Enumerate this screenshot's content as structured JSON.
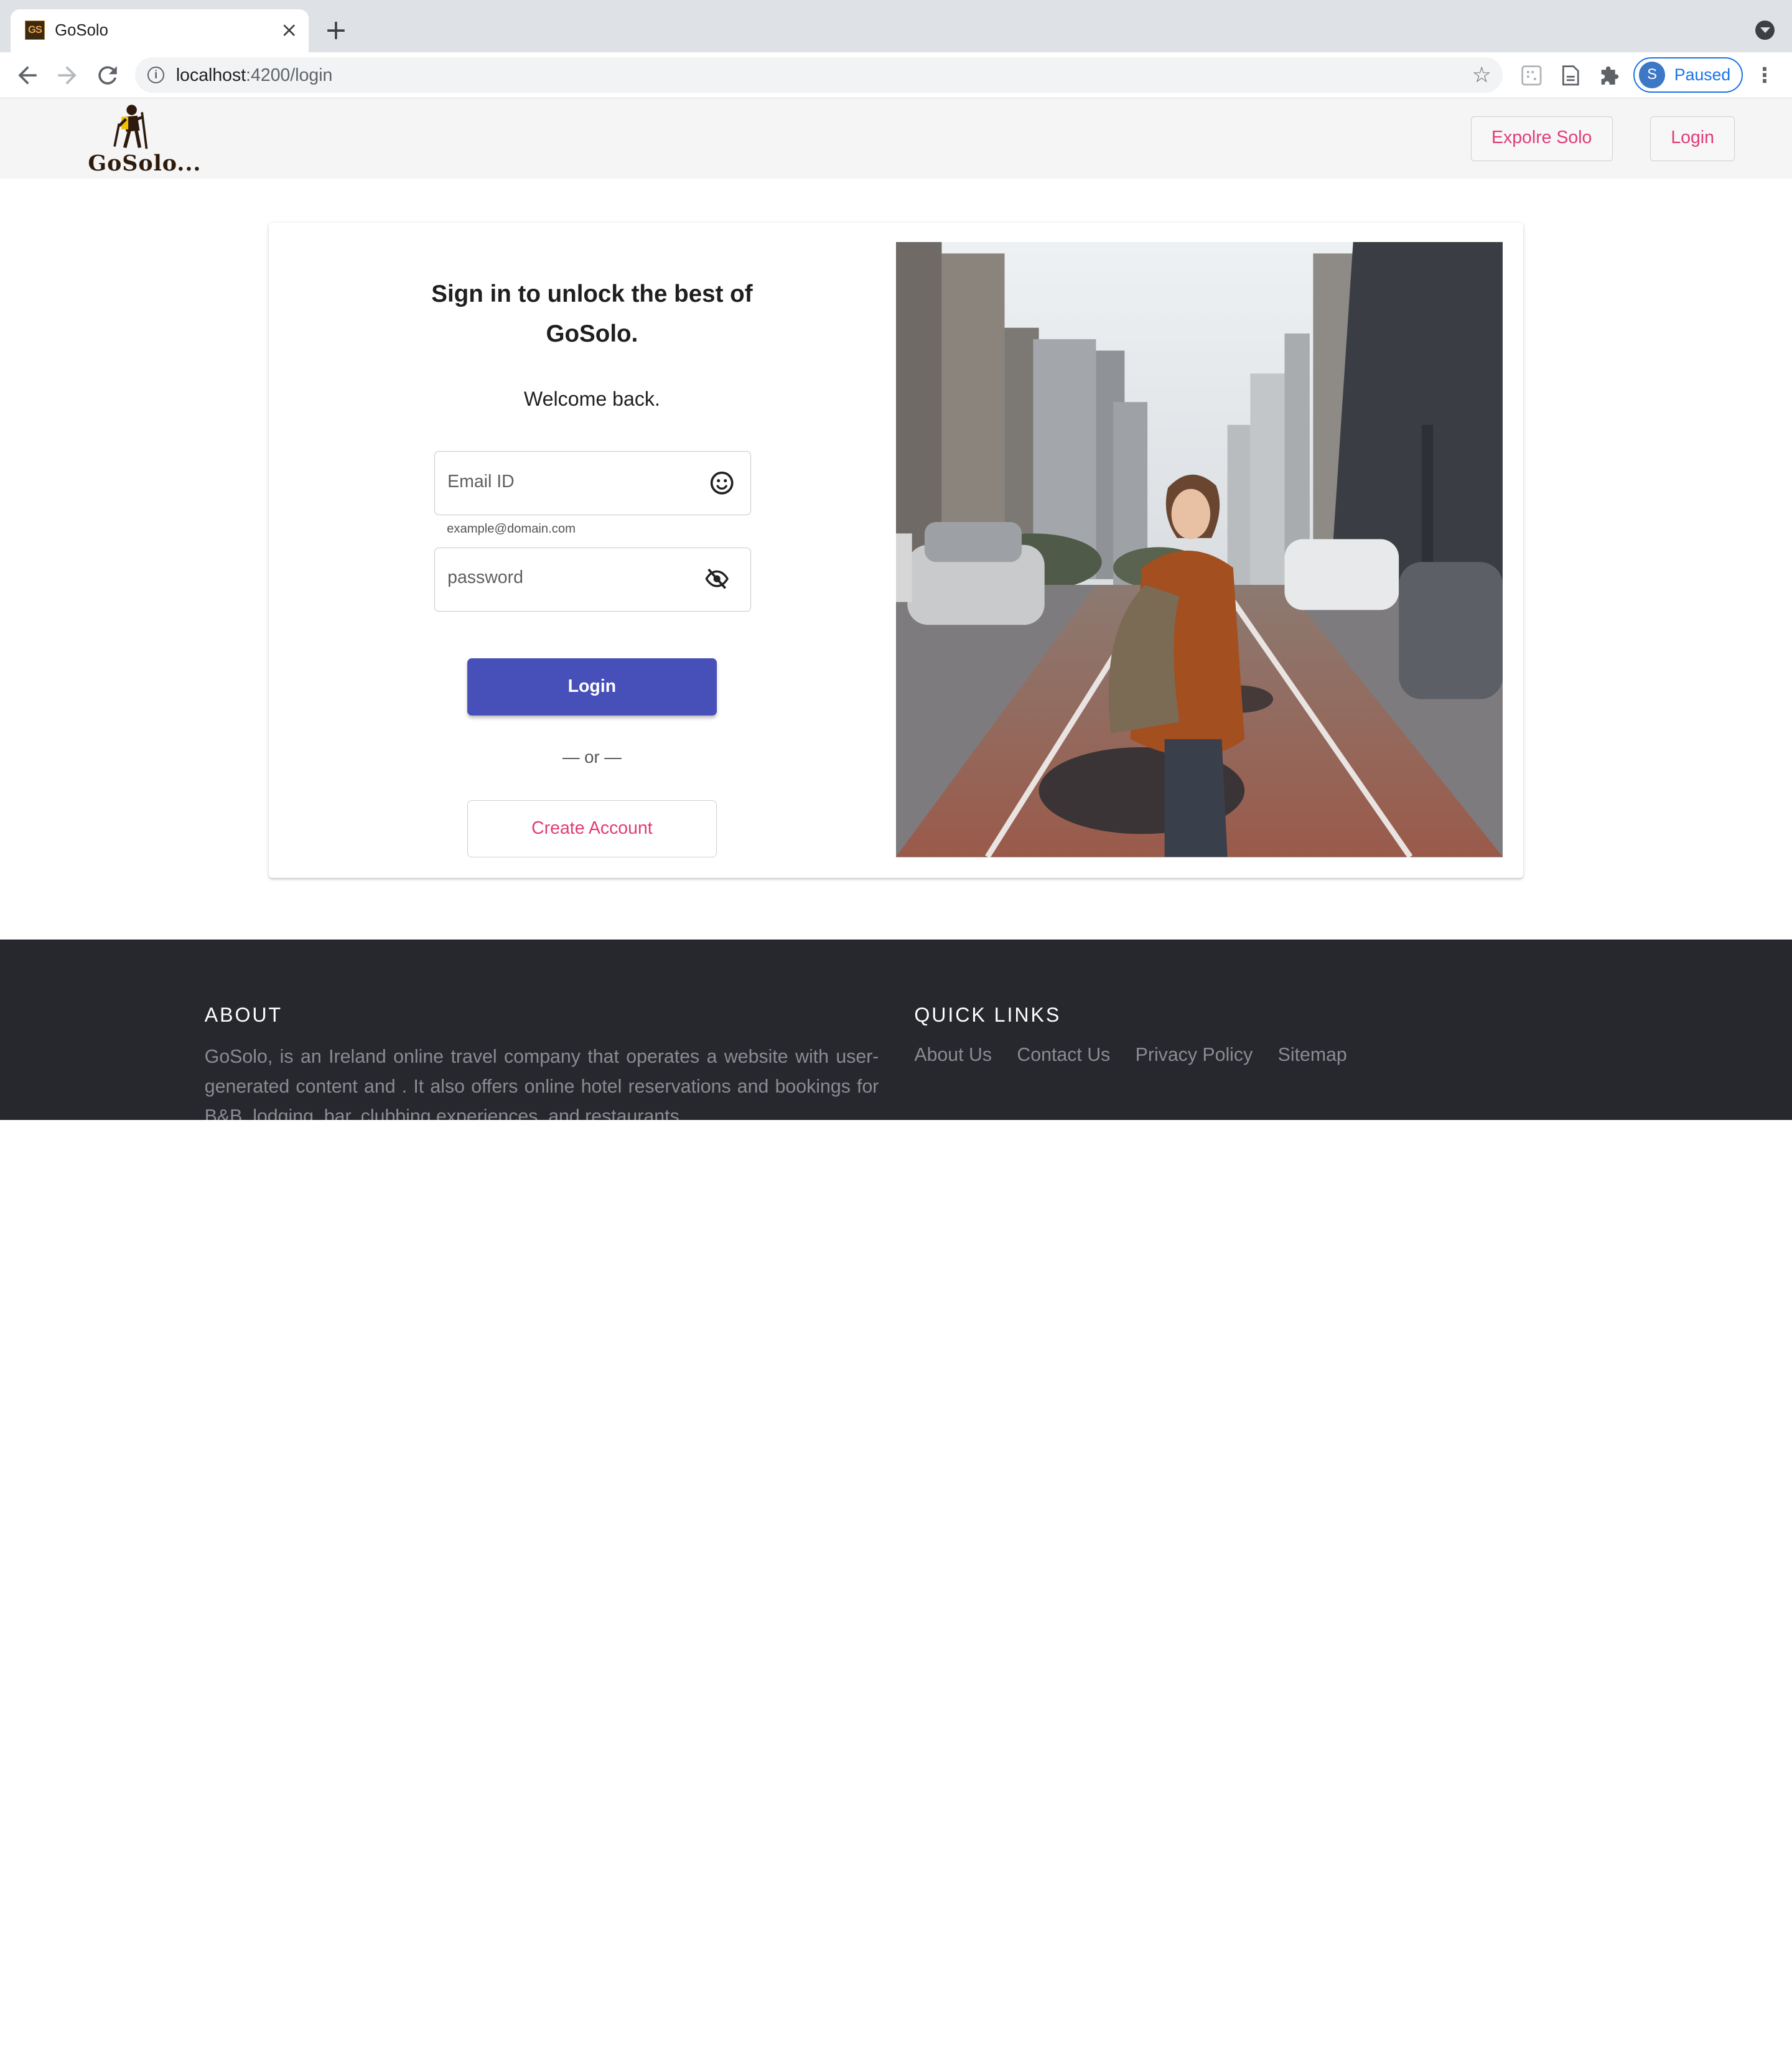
{
  "browser": {
    "tab_title": "GoSolo",
    "favicon_text": "GS",
    "url_host": "localhost",
    "url_path": ":4200/login",
    "profile_initial": "S",
    "profile_status": "Paused"
  },
  "header": {
    "logo_text": "GoSolo...",
    "nav": [
      {
        "label": "Expolre Solo"
      },
      {
        "label": "Login"
      }
    ]
  },
  "login": {
    "heading": "Sign in to unlock the best of GoSolo.",
    "welcome": "Welcome back.",
    "email_placeholder": "Email ID",
    "email_hint": "example@domain.com",
    "password_placeholder": "password",
    "login_button": "Login",
    "or_text": "— or —",
    "create_account_button": "Create Account"
  },
  "footer": {
    "about_heading": "ABOUT",
    "about_text": "GoSolo, is an Ireland online travel company that operates a website with user-generated content and . It also offers online hotel reservations and bookings for B&B, lodging, bar, clubbing experiences, and restaurants.",
    "links_heading": "QUICK LINKS",
    "links": [
      {
        "label": "About Us"
      },
      {
        "label": "Contact Us"
      },
      {
        "label": "Privacy Policy"
      },
      {
        "label": "Sitemap"
      }
    ]
  },
  "colors": {
    "accent_pink": "#e23b78",
    "primary_button": "#4650b8",
    "footer_bg": "#27282d"
  }
}
